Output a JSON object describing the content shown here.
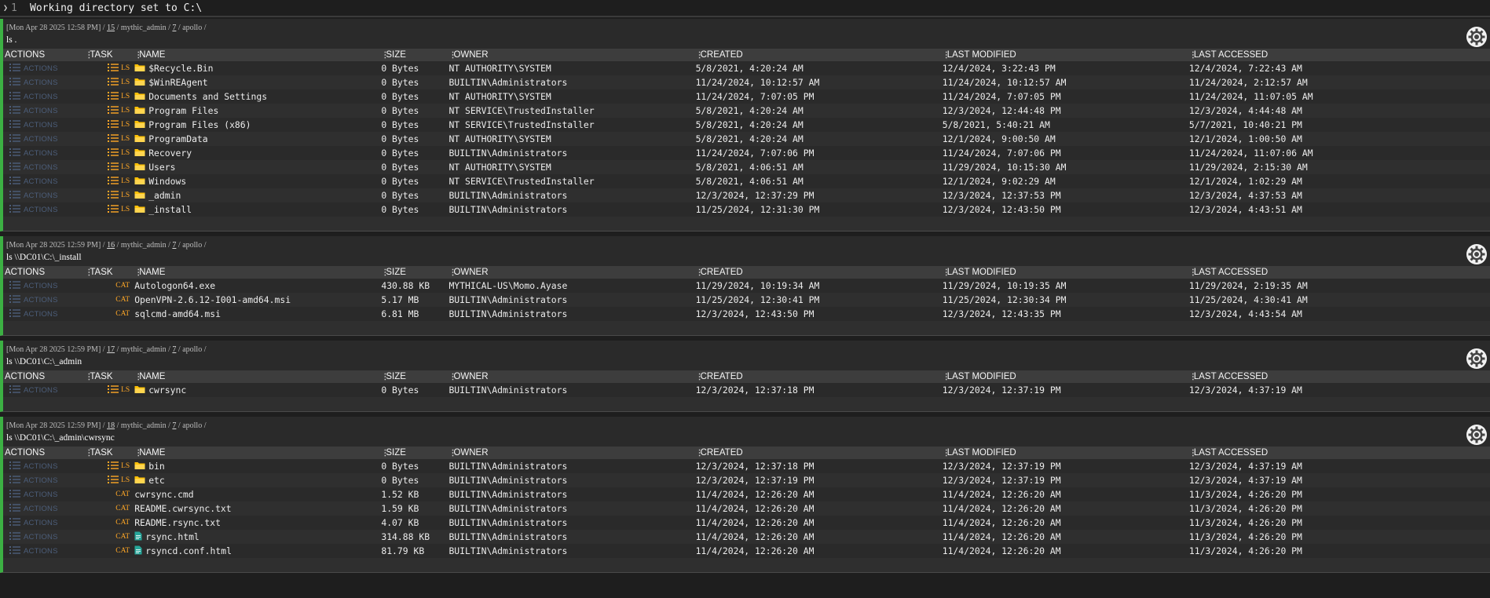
{
  "topline": {
    "line_number": "1",
    "text": "Working directory set to C:\\"
  },
  "columns": [
    "ACTIONS",
    "TASK",
    "NAME",
    "SIZE",
    "OWNER",
    "CREATED",
    "LAST MODIFIED",
    "LAST ACCESSED"
  ],
  "action_label": "ACTIONS",
  "colors": {
    "accent": "#3cb043",
    "task_tag": "#ffa726",
    "folder": "#ffc107",
    "file": "#26a69a",
    "actions_text": "#4c5e7a"
  },
  "tasks": [
    {
      "meta_date": "[Mon Apr 28 2025 12:58 PM]",
      "task_id": "15",
      "operator": "mythic_admin",
      "callback": "7",
      "agent": "apollo",
      "command": "ls .",
      "rows": [
        {
          "task": "LS",
          "icon": "folder",
          "name": "$Recycle.Bin",
          "size": "0 Bytes",
          "owner": "NT AUTHORITY\\SYSTEM",
          "created": "5/8/2021, 4:20:24 AM",
          "modified": "12/4/2024, 3:22:43 PM",
          "accessed": "12/4/2024, 7:22:43 AM"
        },
        {
          "task": "LS",
          "icon": "folder",
          "name": "$WinREAgent",
          "size": "0 Bytes",
          "owner": "BUILTIN\\Administrators",
          "created": "11/24/2024, 10:12:57 AM",
          "modified": "11/24/2024, 10:12:57 AM",
          "accessed": "11/24/2024, 2:12:57 AM"
        },
        {
          "task": "LS",
          "icon": "folder",
          "name": "Documents and Settings",
          "size": "0 Bytes",
          "owner": "NT AUTHORITY\\SYSTEM",
          "created": "11/24/2024, 7:07:05 PM",
          "modified": "11/24/2024, 7:07:05 PM",
          "accessed": "11/24/2024, 11:07:05 AM"
        },
        {
          "task": "LS",
          "icon": "folder",
          "name": "Program Files",
          "size": "0 Bytes",
          "owner": "NT SERVICE\\TrustedInstaller",
          "created": "5/8/2021, 4:20:24 AM",
          "modified": "12/3/2024, 12:44:48 PM",
          "accessed": "12/3/2024, 4:44:48 AM"
        },
        {
          "task": "LS",
          "icon": "folder",
          "name": "Program Files (x86)",
          "size": "0 Bytes",
          "owner": "NT SERVICE\\TrustedInstaller",
          "created": "5/8/2021, 4:20:24 AM",
          "modified": "5/8/2021, 5:40:21 AM",
          "accessed": "5/7/2021, 10:40:21 PM"
        },
        {
          "task": "LS",
          "icon": "folder",
          "name": "ProgramData",
          "size": "0 Bytes",
          "owner": "NT AUTHORITY\\SYSTEM",
          "created": "5/8/2021, 4:20:24 AM",
          "modified": "12/1/2024, 9:00:50 AM",
          "accessed": "12/1/2024, 1:00:50 AM"
        },
        {
          "task": "LS",
          "icon": "folder",
          "name": "Recovery",
          "size": "0 Bytes",
          "owner": "BUILTIN\\Administrators",
          "created": "11/24/2024, 7:07:06 PM",
          "modified": "11/24/2024, 7:07:06 PM",
          "accessed": "11/24/2024, 11:07:06 AM"
        },
        {
          "task": "LS",
          "icon": "folder",
          "name": "Users",
          "size": "0 Bytes",
          "owner": "NT AUTHORITY\\SYSTEM",
          "created": "5/8/2021, 4:06:51 AM",
          "modified": "11/29/2024, 10:15:30 AM",
          "accessed": "11/29/2024, 2:15:30 AM"
        },
        {
          "task": "LS",
          "icon": "folder",
          "name": "Windows",
          "size": "0 Bytes",
          "owner": "NT SERVICE\\TrustedInstaller",
          "created": "5/8/2021, 4:06:51 AM",
          "modified": "12/1/2024, 9:02:29 AM",
          "accessed": "12/1/2024, 1:02:29 AM"
        },
        {
          "task": "LS",
          "icon": "folder",
          "name": "_admin",
          "size": "0 Bytes",
          "owner": "BUILTIN\\Administrators",
          "created": "12/3/2024, 12:37:29 PM",
          "modified": "12/3/2024, 12:37:53 PM",
          "accessed": "12/3/2024, 4:37:53 AM"
        },
        {
          "task": "LS",
          "icon": "folder",
          "name": "_install",
          "size": "0 Bytes",
          "owner": "BUILTIN\\Administrators",
          "created": "11/25/2024, 12:31:30 PM",
          "modified": "12/3/2024, 12:43:50 PM",
          "accessed": "12/3/2024, 4:43:51 AM"
        }
      ]
    },
    {
      "meta_date": "[Mon Apr 28 2025 12:59 PM]",
      "task_id": "16",
      "operator": "mythic_admin",
      "callback": "7",
      "agent": "apollo",
      "command": "ls \\\\DC01\\C:\\_install",
      "rows": [
        {
          "task": "CAT",
          "icon": "none",
          "name": "Autologon64.exe",
          "size": "430.88 KB",
          "owner": "MYTHICAL-US\\Momo.Ayase",
          "created": "11/29/2024, 10:19:34 AM",
          "modified": "11/29/2024, 10:19:35 AM",
          "accessed": "11/29/2024, 2:19:35 AM"
        },
        {
          "task": "CAT",
          "icon": "none",
          "name": "OpenVPN-2.6.12-I001-amd64.msi",
          "size": "5.17 MB",
          "owner": "BUILTIN\\Administrators",
          "created": "11/25/2024, 12:30:41 PM",
          "modified": "11/25/2024, 12:30:34 PM",
          "accessed": "11/25/2024, 4:30:41 AM"
        },
        {
          "task": "CAT",
          "icon": "none",
          "name": "sqlcmd-amd64.msi",
          "size": "6.81 MB",
          "owner": "BUILTIN\\Administrators",
          "created": "12/3/2024, 12:43:50 PM",
          "modified": "12/3/2024, 12:43:35 PM",
          "accessed": "12/3/2024, 4:43:54 AM"
        }
      ]
    },
    {
      "meta_date": "[Mon Apr 28 2025 12:59 PM]",
      "task_id": "17",
      "operator": "mythic_admin",
      "callback": "7",
      "agent": "apollo",
      "command": "ls \\\\DC01\\C:\\_admin",
      "rows": [
        {
          "task": "LS",
          "icon": "folder",
          "name": "cwrsync",
          "size": "0 Bytes",
          "owner": "BUILTIN\\Administrators",
          "created": "12/3/2024, 12:37:18 PM",
          "modified": "12/3/2024, 12:37:19 PM",
          "accessed": "12/3/2024, 4:37:19 AM"
        }
      ]
    },
    {
      "meta_date": "[Mon Apr 28 2025 12:59 PM]",
      "task_id": "18",
      "operator": "mythic_admin",
      "callback": "7",
      "agent": "apollo",
      "command": "ls \\\\DC01\\C:\\_admin\\cwrsync",
      "rows": [
        {
          "task": "LS",
          "icon": "folder",
          "name": "bin",
          "size": "0 Bytes",
          "owner": "BUILTIN\\Administrators",
          "created": "12/3/2024, 12:37:18 PM",
          "modified": "12/3/2024, 12:37:19 PM",
          "accessed": "12/3/2024, 4:37:19 AM"
        },
        {
          "task": "LS",
          "icon": "folder",
          "name": "etc",
          "size": "0 Bytes",
          "owner": "BUILTIN\\Administrators",
          "created": "12/3/2024, 12:37:19 PM",
          "modified": "12/3/2024, 12:37:19 PM",
          "accessed": "12/3/2024, 4:37:19 AM"
        },
        {
          "task": "CAT",
          "icon": "none",
          "name": "cwrsync.cmd",
          "size": "1.52 KB",
          "owner": "BUILTIN\\Administrators",
          "created": "11/4/2024, 12:26:20 AM",
          "modified": "11/4/2024, 12:26:20 AM",
          "accessed": "11/3/2024, 4:26:20 PM"
        },
        {
          "task": "CAT",
          "icon": "none",
          "name": "README.cwrsync.txt",
          "size": "1.59 KB",
          "owner": "BUILTIN\\Administrators",
          "created": "11/4/2024, 12:26:20 AM",
          "modified": "11/4/2024, 12:26:20 AM",
          "accessed": "11/3/2024, 4:26:20 PM"
        },
        {
          "task": "CAT",
          "icon": "none",
          "name": "README.rsync.txt",
          "size": "4.07 KB",
          "owner": "BUILTIN\\Administrators",
          "created": "11/4/2024, 12:26:20 AM",
          "modified": "11/4/2024, 12:26:20 AM",
          "accessed": "11/3/2024, 4:26:20 PM"
        },
        {
          "task": "CAT",
          "icon": "file",
          "name": "rsync.html",
          "size": "314.88 KB",
          "owner": "BUILTIN\\Administrators",
          "created": "11/4/2024, 12:26:20 AM",
          "modified": "11/4/2024, 12:26:20 AM",
          "accessed": "11/3/2024, 4:26:20 PM"
        },
        {
          "task": "CAT",
          "icon": "file",
          "name": "rsyncd.conf.html",
          "size": "81.79 KB",
          "owner": "BUILTIN\\Administrators",
          "created": "11/4/2024, 12:26:20 AM",
          "modified": "11/4/2024, 12:26:20 AM",
          "accessed": "11/3/2024, 4:26:20 PM"
        }
      ]
    }
  ]
}
